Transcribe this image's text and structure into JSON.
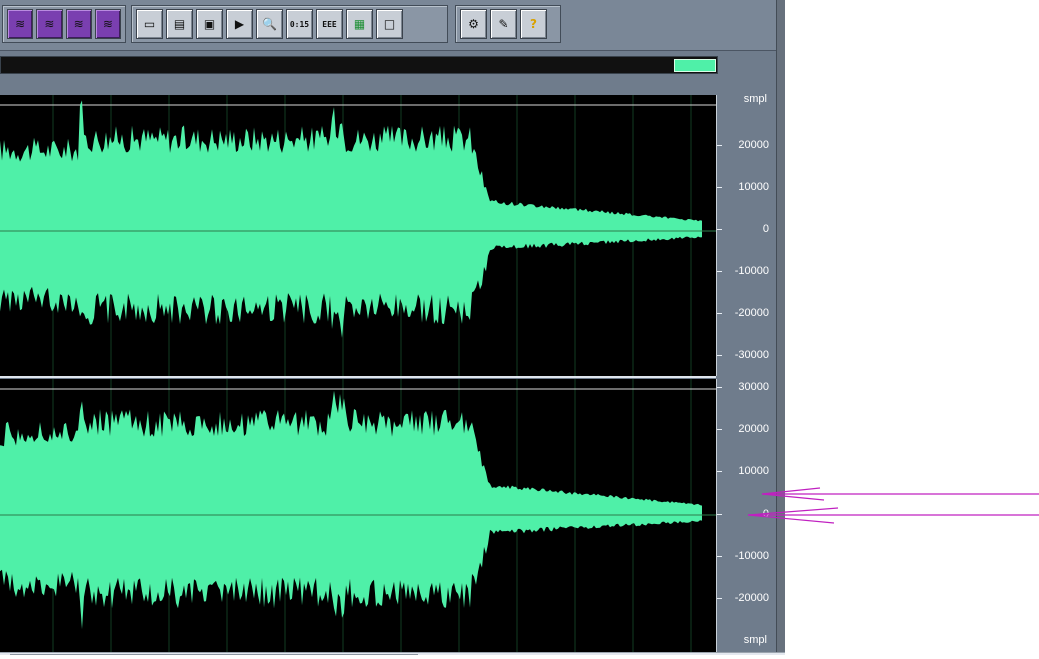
{
  "app": {
    "toolbar": {
      "groups": [
        [
          {
            "icon": "purple-wave-view-icon",
            "label": ""
          },
          {
            "icon": "purple-multitrack-icon",
            "label": ""
          },
          {
            "icon": "purple-spectral-icon",
            "label": ""
          },
          {
            "icon": "purple-edit-icon",
            "label": ""
          }
        ],
        [
          {
            "icon": "window-icon",
            "label": ""
          },
          {
            "icon": "cue-list-icon",
            "label": ""
          },
          {
            "icon": "playlist-icon",
            "label": ""
          },
          {
            "icon": "play-icon",
            "label": "▶"
          },
          {
            "icon": "zoom-icon",
            "label": "🔍"
          },
          {
            "icon": "time-display-icon",
            "label": "0:15"
          },
          {
            "icon": "level-meter-icon",
            "label": "EEE"
          },
          {
            "icon": "color-bars-icon",
            "label": ""
          },
          {
            "icon": "blank-window-icon",
            "label": ""
          }
        ],
        [
          {
            "icon": "settings-icon",
            "label": ""
          },
          {
            "icon": "script-icon",
            "label": ""
          },
          {
            "icon": "help-icon",
            "label": "?"
          }
        ]
      ]
    },
    "overview": {
      "range_color": "#4ff0a8"
    },
    "waveform": {
      "color": "#4ff0a8",
      "background": "#000000",
      "top_channel": {
        "unit": "smpl",
        "ticks": [
          "20000",
          "10000",
          "0",
          "-10000",
          "-20000",
          "-30000"
        ]
      },
      "bottom_channel": {
        "unit": "smpl",
        "ticks": [
          "30000",
          "20000",
          "10000",
          "0",
          "-10000",
          "-20000"
        ]
      }
    },
    "annotation": {
      "arrow_color": "#c020c0"
    }
  }
}
